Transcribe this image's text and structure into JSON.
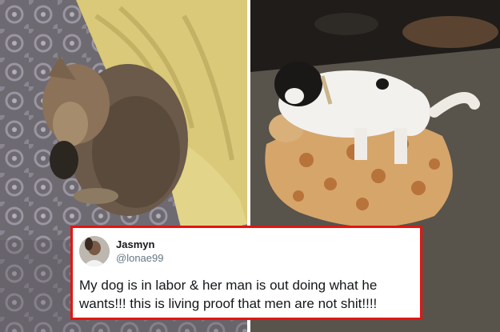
{
  "tweet": {
    "display_name": "Jasmyn",
    "handle": "@lonae99",
    "text": "My dog is in labor & her man is out doing what he wants!!! this is living proof that men are not shit!!!!",
    "border_color": "#e4150f"
  },
  "photos": {
    "left_subject": "pregnant-dog-photo",
    "right_subject": "dog-on-giraffe-toy-photo"
  }
}
